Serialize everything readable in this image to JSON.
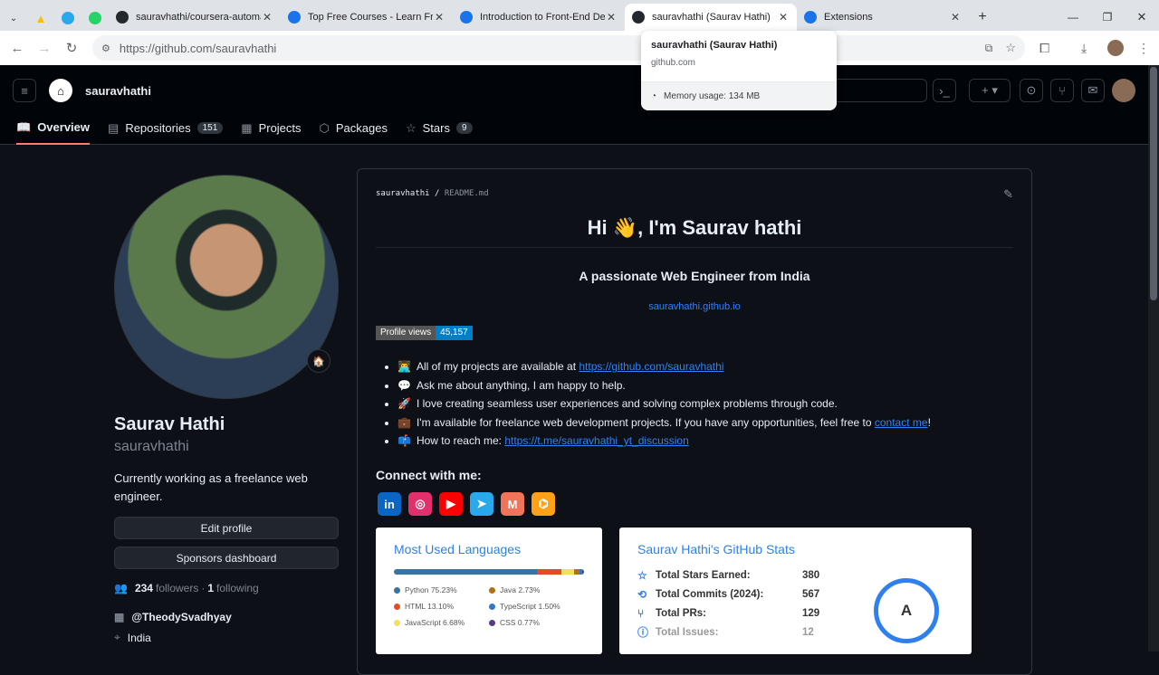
{
  "browser": {
    "tabs": [
      {
        "label": "sauravhathi/coursera-automa",
        "icon_color": "#24292f"
      },
      {
        "label": "Top Free Courses - Learn Free",
        "icon_color": "#1a73e8"
      },
      {
        "label": "Introduction to Front-End De",
        "icon_color": "#1a73e8"
      },
      {
        "label": "sauravhathi (Saurav Hathi)",
        "icon_color": "#24292f",
        "active": true
      },
      {
        "label": "Extensions",
        "icon_color": "#1a73e8"
      }
    ],
    "url": "https://github.com/sauravhathi",
    "hover_card": {
      "title": "sauravhathi (Saurav Hathi)",
      "domain": "github.com",
      "memory": "Memory usage: 134 MB"
    }
  },
  "header": {
    "username": "sauravhathi"
  },
  "nav": {
    "tabs": [
      {
        "label": "Overview",
        "count": null
      },
      {
        "label": "Repositories",
        "count": "151"
      },
      {
        "label": "Projects",
        "count": null
      },
      {
        "label": "Packages",
        "count": null
      },
      {
        "label": "Stars",
        "count": "9"
      }
    ]
  },
  "profile": {
    "name": "Saurav Hathi",
    "login": "sauravhathi",
    "bio": "Currently working as a freelance web engineer.",
    "edit_label": "Edit profile",
    "sponsors_label": "Sponsors dashboard",
    "followers": "234",
    "followers_label": "followers",
    "following": "1",
    "following_label": "following",
    "org": "@TheodySvadhyay",
    "location": "India"
  },
  "readme": {
    "path_user": "sauravhathi",
    "path_file": "README.md",
    "greeting": "Hi 👋, I'm Saurav hathi",
    "subtitle": "A passionate Web Engineer from India",
    "site": "sauravhathi.github.io",
    "views_label": "Profile views",
    "views_value": "45,157",
    "bullets": [
      {
        "emoji": "👨‍💻",
        "text": "All of my projects are available at ",
        "link": "https://github.com/sauravhathi",
        "after": ""
      },
      {
        "emoji": "💬",
        "text": "Ask me about anything, I am happy to help.",
        "link": "",
        "after": ""
      },
      {
        "emoji": "🚀",
        "text": "I love creating seamless user experiences and solving complex problems through code.",
        "link": "",
        "after": ""
      },
      {
        "emoji": "💼",
        "text": "I'm available for freelance web development projects. If you have any opportunities, feel free to ",
        "link": "contact me",
        "after": "!"
      },
      {
        "emoji": "📫",
        "text": "How to reach me: ",
        "link": "https://t.me/sauravhathi_yt_discussion",
        "after": ""
      }
    ],
    "connect": "Connect with me:",
    "socials": [
      {
        "name": "linkedin",
        "glyph": "in",
        "color": "#0a66c2"
      },
      {
        "name": "instagram",
        "glyph": "◎",
        "color": "#e1306c"
      },
      {
        "name": "youtube",
        "glyph": "▶",
        "color": "#ff0000"
      },
      {
        "name": "telegram",
        "glyph": "➤",
        "color": "#29a9eb"
      },
      {
        "name": "medium",
        "glyph": "M",
        "color": "#f0735a"
      },
      {
        "name": "leetcode",
        "glyph": "⌬",
        "color": "#ffa116"
      }
    ]
  },
  "languages": {
    "title": "Most Used Languages",
    "items": [
      {
        "name": "Python 75.23%",
        "pct": 75.23,
        "color": "#3572A5"
      },
      {
        "name": "Java 2.73%",
        "pct": 2.73,
        "color": "#b07219"
      },
      {
        "name": "HTML 13.10%",
        "pct": 13.1,
        "color": "#e34c26"
      },
      {
        "name": "TypeScript 1.50%",
        "pct": 1.5,
        "color": "#3178c6"
      },
      {
        "name": "JavaScript 6.68%",
        "pct": 6.68,
        "color": "#f1e05a"
      },
      {
        "name": "CSS 0.77%",
        "pct": 0.77,
        "color": "#563d7c"
      }
    ]
  },
  "stats": {
    "title": "Saurav Hathi's GitHub Stats",
    "rows": [
      {
        "icon": "☆",
        "label": "Total Stars Earned:",
        "value": "380"
      },
      {
        "icon": "⟲",
        "label": "Total Commits (2024):",
        "value": "567"
      },
      {
        "icon": "⑂",
        "label": "Total PRs:",
        "value": "129"
      },
      {
        "icon": "ⓘ",
        "label": "Total Issues:",
        "value": "12"
      }
    ],
    "grade": "A"
  }
}
